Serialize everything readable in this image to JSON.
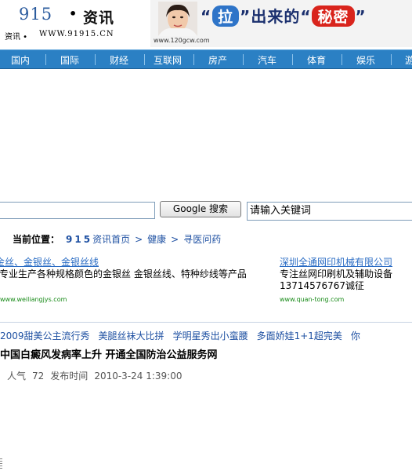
{
  "header": {
    "logo_number": "915",
    "logo_dot": "•",
    "logo_title": "资讯",
    "logo_subtitle": "资讯 •",
    "logo_url": "WWW.91915.CN"
  },
  "banner": {
    "url": "www.120gcw.com",
    "quote_open": "“",
    "pull_word": "拉",
    "quote_close": "”",
    "middle_text": "出来的",
    "secret_word": "秘密"
  },
  "nav": {
    "items": [
      "国内",
      "国际",
      "财经",
      "互联网",
      "房产",
      "汽车",
      "体育",
      "娱乐",
      "游"
    ]
  },
  "search": {
    "left_value": "",
    "button_label": "Google 搜索",
    "right_value": "请输入关键词"
  },
  "breadcrumb": {
    "label": "当前位置：",
    "home_number": "915",
    "home_text": "资讯首页",
    "arrow": ">",
    "items": [
      "健康",
      "寻医问药"
    ]
  },
  "ads": {
    "left": {
      "title": "金丝、金银丝、金银丝线",
      "description": "专业生产各种规格颜色的金银丝 金银丝线、特种纱线等产品",
      "url": "www.weiliangjys.com"
    },
    "right": {
      "title": "深圳全通网印机械有限公司",
      "description": "专注丝网印刷机及辅助设备 13714576767诚征",
      "url": "www.quan-tong.com"
    }
  },
  "ticker": {
    "items": [
      "2009甜美公主流行秀",
      "美腿丝袜大比拼",
      "学明星秀出小蛮腰",
      "多面娇娃1+1超完美",
      "你"
    ]
  },
  "article": {
    "title": "中国白癜风发病率上升  开通全国防治公益服务网",
    "popularity_label": "人气",
    "popularity_value": "72",
    "date_label": "发布时间",
    "date_value": "2010-3-24 1:39:00"
  },
  "colors": {
    "nav_bg": "#2b80c4",
    "link": "#1e50a2",
    "ad_title": "#2a6cc4",
    "ad_url": "#178a17"
  }
}
